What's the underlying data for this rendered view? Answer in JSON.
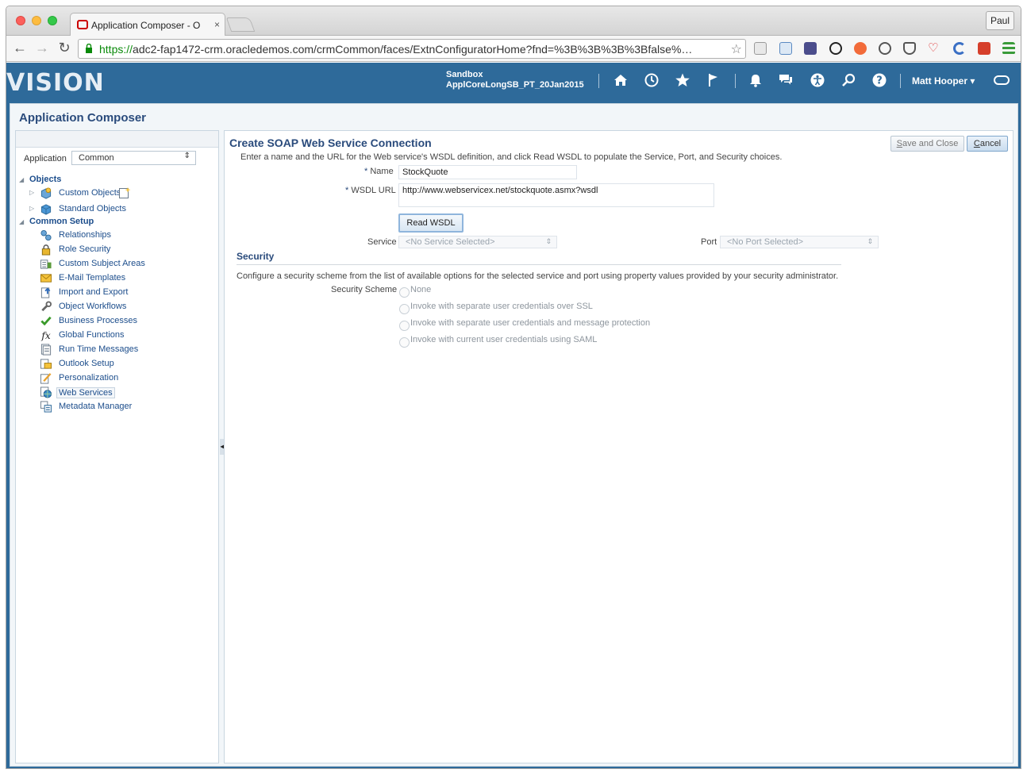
{
  "browser": {
    "tab_title": "Application Composer - O",
    "tab_close": "×",
    "profile_name": "Paul",
    "url_scheme": "https://",
    "url_rest": "adc2-fap1472-crm.oracledemos.com/crmCommon/faces/ExtnConfiguratorHome?fnd=%3B%3B%3B%3Bfalse%…",
    "nav": {
      "back": "←",
      "forward": "→",
      "reload": "↻"
    },
    "star": "☆"
  },
  "header": {
    "logo": "VISION",
    "sandbox_label": "Sandbox",
    "sandbox_name": "ApplCoreLongSB_PT_20Jan2015",
    "user_name": "Matt Hooper ▾",
    "icons": [
      "home-icon",
      "recent-icon",
      "favorites-icon",
      "flag-icon",
      "notifications-icon",
      "messages-icon",
      "accessibility-icon",
      "search-icon",
      "help-icon",
      "signout-icon"
    ]
  },
  "page_title": "Application Composer",
  "sidebar": {
    "application_label": "Application",
    "application_value": "Common",
    "objects_label": "Objects",
    "objects": [
      {
        "label": "Custom Objects",
        "icon": "custom-objects-icon"
      },
      {
        "label": "Standard Objects",
        "icon": "standard-objects-icon"
      }
    ],
    "common_setup_label": "Common Setup",
    "common_setup": [
      {
        "label": "Relationships",
        "icon": "relationships-icon"
      },
      {
        "label": "Role Security",
        "icon": "lock-icon"
      },
      {
        "label": "Custom Subject Areas",
        "icon": "subject-areas-icon"
      },
      {
        "label": "E-Mail Templates",
        "icon": "email-icon"
      },
      {
        "label": "Import and Export",
        "icon": "import-export-icon"
      },
      {
        "label": "Object Workflows",
        "icon": "workflow-icon"
      },
      {
        "label": "Business Processes",
        "icon": "checkmark-icon"
      },
      {
        "label": "Global Functions",
        "icon": "function-icon"
      },
      {
        "label": "Run Time Messages",
        "icon": "messages-icon"
      },
      {
        "label": "Outlook Setup",
        "icon": "outlook-icon"
      },
      {
        "label": "Personalization",
        "icon": "personalization-icon"
      },
      {
        "label": "Web Services",
        "icon": "web-services-icon"
      },
      {
        "label": "Metadata Manager",
        "icon": "metadata-icon"
      }
    ]
  },
  "form": {
    "title": "Create SOAP Web Service Connection",
    "instructions": "Enter a name and the URL for the Web service's WSDL definition, and click Read WSDL to populate the Service, Port, and Security choices.",
    "save_close_label": "Save and Close",
    "cancel_label": "Cancel",
    "name_label": "Name",
    "name_value": "StockQuote",
    "wsdl_label": "WSDL URL",
    "wsdl_value": "http://www.webservicex.net/stockquote.asmx?wsdl",
    "read_wsdl_label": "Read WSDL",
    "service_label": "Service",
    "service_value": "<No Service Selected>",
    "port_label": "Port",
    "port_value": "<No Port Selected>",
    "required_marker": "*"
  },
  "security": {
    "title": "Security",
    "instructions": "Configure a security scheme from the list of available options for the selected service and port using property values provided by your security administrator.",
    "scheme_label": "Security Scheme",
    "options": [
      "None",
      "Invoke with separate user credentials over SSL",
      "Invoke with separate user credentials and message protection",
      "Invoke with current user credentials using SAML"
    ]
  },
  "colors": {
    "header_bg": "#2e6a9a",
    "title_blue": "#2a4b7c",
    "link_blue": "#1d4e8c"
  }
}
